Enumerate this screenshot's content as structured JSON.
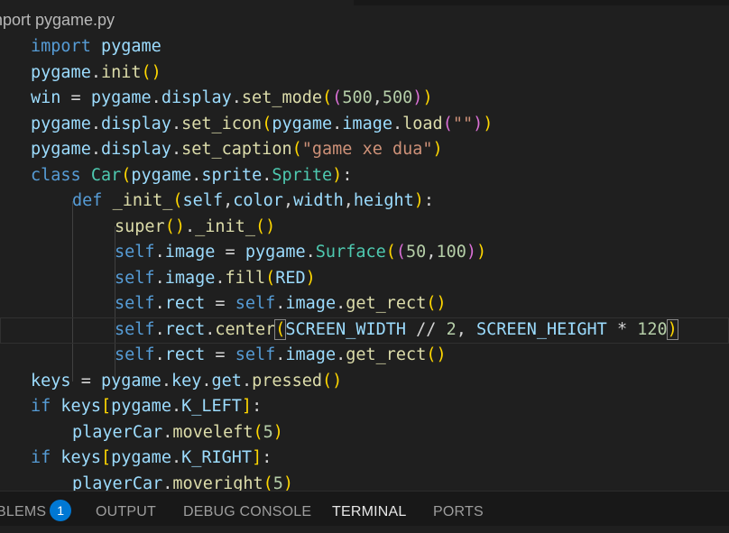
{
  "breadcrumb": {
    "file": "mport pygame.py"
  },
  "editor": {
    "lines": [
      {
        "id": "l1"
      },
      {
        "id": "l2"
      }
    ]
  },
  "code": {
    "l1_import": "import",
    "l1_mod": "pygame",
    "l2_mod": "pygame",
    "l2_fn": "init",
    "l3_win": "win",
    "l3_mod": "pygame",
    "l3_display": "display",
    "l3_fn": "set_mode",
    "l3_n1": "500",
    "l3_n2": "500",
    "l4_mod": "pygame",
    "l4_display": "display",
    "l4_fn": "set_icon",
    "l4_mod2": "pygame",
    "l4_image": "image",
    "l4_load": "load",
    "l4_str": "\"\"",
    "l5_mod": "pygame",
    "l5_display": "display",
    "l5_fn": "set_caption",
    "l5_str": "\"game xe dua\"",
    "l6_class": "class",
    "l6_name": "Car",
    "l6_mod": "pygame",
    "l6_sprite": "sprite",
    "l6_Sprite": "Sprite",
    "l7_def": "def",
    "l7_fn": "_init_",
    "l7_self": "self",
    "l7_color": "color",
    "l7_width": "width",
    "l7_height": "height",
    "l8_super": "super",
    "l8_fn": "_init_",
    "l9_self": "self",
    "l9_image": "image",
    "l9_mod": "pygame",
    "l9_Surface": "Surface",
    "l9_n1": "50",
    "l9_n2": "100",
    "l10_self": "self",
    "l10_image": "image",
    "l10_fill": "fill",
    "l10_RED": "RED",
    "l11_self": "self",
    "l11_rect": "rect",
    "l11_self2": "self",
    "l11_image": "image",
    "l11_fn": "get_rect",
    "l12_self": "self",
    "l12_rect": "rect",
    "l12_center": "center",
    "l12_W": "SCREEN_WIDTH",
    "l12_n1": "2",
    "l12_H": "SCREEN_HEIGHT",
    "l12_n2": "120",
    "l13_self": "self",
    "l13_rect": "rect",
    "l13_self2": "self",
    "l13_image": "image",
    "l13_fn": "get_rect",
    "l14_keys": "keys",
    "l14_mod": "pygame",
    "l14_key": "key",
    "l14_get": "get",
    "l14_fn": "pressed",
    "l15_if": "if",
    "l15_keys": "keys",
    "l15_mod": "pygame",
    "l15_K": "K_LEFT",
    "l16_player": "playerCar",
    "l16_fn": "moveleft",
    "l16_n": "5",
    "l17_if": "if",
    "l17_keys": "keys",
    "l17_mod": "pygame",
    "l17_K": "K_RIGHT",
    "l18_player": "playerCar",
    "l18_fn": "moveright",
    "l18_n": "5"
  },
  "panel": {
    "problems_label": "BLEMS",
    "problems_count": "1",
    "output_label": "OUTPUT",
    "debug_label": "DEBUG CONSOLE",
    "terminal_label": "TERMINAL",
    "ports_label": "PORTS",
    "active_tab": "TERMINAL"
  },
  "colors": {
    "background": "#1f1f1f",
    "keyword": "#569cd6",
    "variable": "#9cdcfe",
    "function": "#dcdcaa",
    "class": "#4ec9b0",
    "number": "#b5cea8",
    "string": "#ce9178",
    "badge": "#0078d4"
  }
}
